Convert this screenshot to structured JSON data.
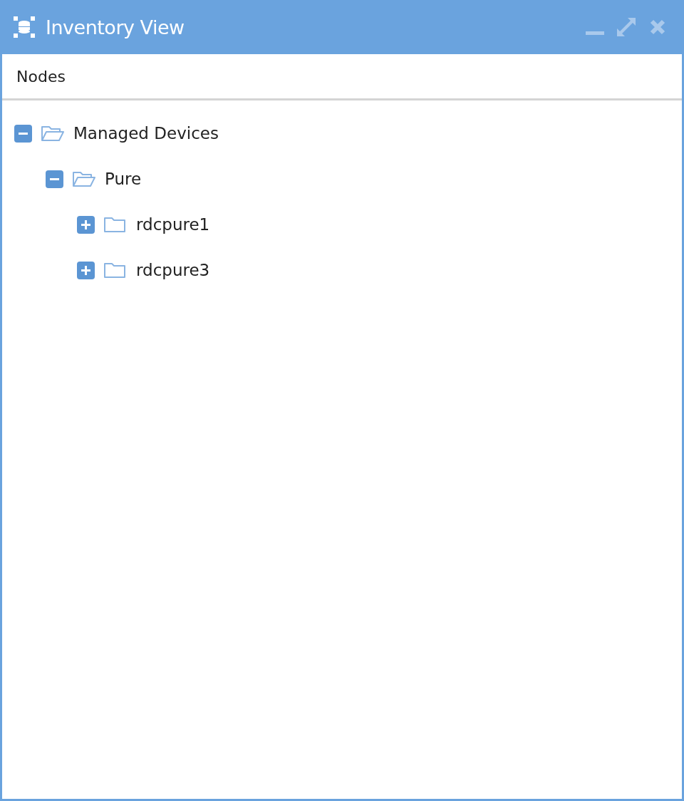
{
  "window": {
    "title": "Inventory View"
  },
  "panel": {
    "header": "Nodes"
  },
  "tree": [
    {
      "label": "Managed Devices",
      "expanded": true,
      "children": [
        {
          "label": "Pure",
          "expanded": true,
          "children": [
            {
              "label": "rdcpure1",
              "expanded": false
            },
            {
              "label": "rdcpure3",
              "expanded": false
            }
          ]
        }
      ]
    }
  ]
}
